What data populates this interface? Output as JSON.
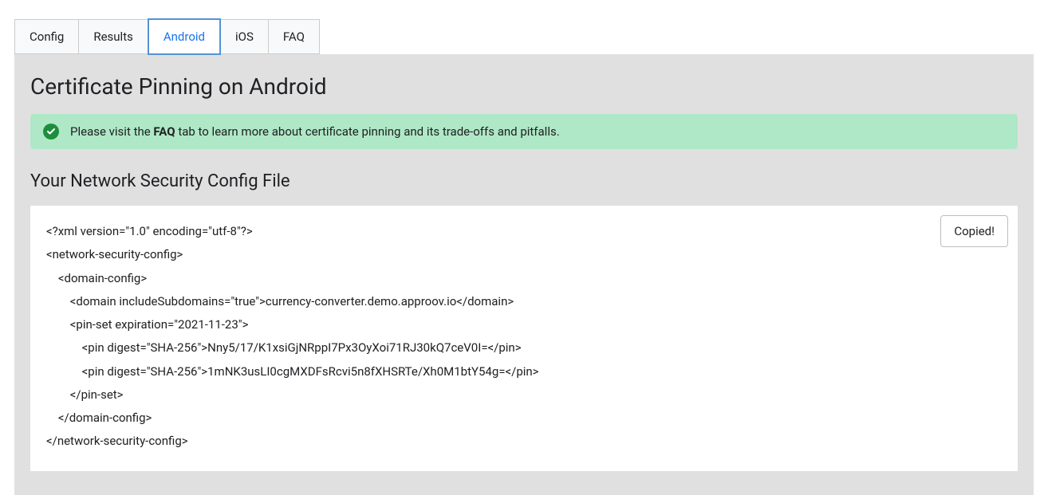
{
  "tabs": {
    "items": [
      "Config",
      "Results",
      "Android",
      "iOS",
      "FAQ"
    ],
    "activeIndex": 2
  },
  "panel": {
    "title": "Certificate Pinning on Android",
    "alert": {
      "prefix": "Please visit the ",
      "bold": "FAQ",
      "suffix": " tab to learn more about certificate pinning and its trade-offs and pitfalls."
    },
    "sectionTitle": "Your Network Security Config File",
    "copyButton": "Copied!",
    "code": "<?xml version=\"1.0\" encoding=\"utf-8\"?>\n<network-security-config>\n    <domain-config>\n        <domain includeSubdomains=\"true\">currency-converter.demo.approov.io</domain>\n        <pin-set expiration=\"2021-11-23\">\n            <pin digest=\"SHA-256\">Nny5/17/K1xsiGjNRppI7Px3OyXoi71RJ30kQ7ceV0I=</pin>\n            <pin digest=\"SHA-256\">1mNK3usLI0cgMXDFsRcvi5n8fXHSRTe/Xh0M1btY54g=</pin>\n        </pin-set>\n    </domain-config>\n</network-security-config>"
  }
}
